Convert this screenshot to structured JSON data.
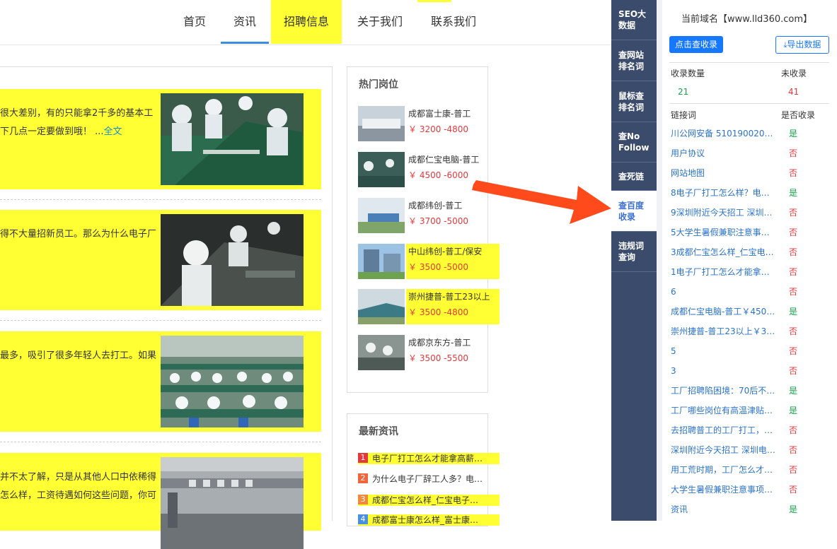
{
  "nav": {
    "items": [
      {
        "label": "首页"
      },
      {
        "label": "资讯"
      },
      {
        "label": "招聘信息"
      },
      {
        "label": "关于我们"
      },
      {
        "label": "联系我们"
      }
    ]
  },
  "articles": [
    {
      "lines": [
        "很大差别，有的只能拿2千多的基本工",
        "下几点一定要做到哦！ ..."
      ],
      "more": "全文"
    },
    {
      "lines": [
        "得不大量招新员工。那么为什么电子厂"
      ],
      "more": ""
    },
    {
      "lines": [
        "最多，吸引了很多年轻人去打工。如果"
      ],
      "more": ""
    },
    {
      "lines": [
        "并不太了解，只是从其他人口中依稀得",
        "怎么样，工资待遇如何这些问题，你可"
      ],
      "more": ""
    }
  ],
  "hot_jobs": {
    "title": "热门岗位",
    "items": [
      {
        "name": "成都富士康-普工",
        "pay": "￥ 3200 -4800"
      },
      {
        "name": "成都仁宝电脑-普工",
        "pay": "￥ 4500 -6000"
      },
      {
        "name": "成都纬创-普工",
        "pay": "￥ 3700 -5000"
      },
      {
        "name": "中山纬创-普工/保安",
        "pay": "￥ 3500 -5000"
      },
      {
        "name": "崇州捷普-普工23以上",
        "pay": "￥ 3500 -4800"
      },
      {
        "name": "成都京东方-普工",
        "pay": "￥ 3500 -5500"
      }
    ]
  },
  "latest_news": {
    "title": "最新资讯",
    "items": [
      {
        "num": "1",
        "text": "电子厂打工怎么才能拿高薪…"
      },
      {
        "num": "2",
        "text": "为什么电子厂辞工人多？电…"
      },
      {
        "num": "3",
        "text": "成都仁宝怎么样_仁宝电子…"
      },
      {
        "num": "4",
        "text": "成都富士康怎么样_富士康…"
      }
    ]
  },
  "seo_sidebar": {
    "tabs": [
      {
        "label": "SEO大数据"
      },
      {
        "label": "查网站排名词"
      },
      {
        "label": "鼠标查排名词"
      },
      {
        "label": "查No Follow"
      },
      {
        "label": "查死链"
      },
      {
        "label": "查百度收录"
      },
      {
        "label": "违规词查询"
      }
    ]
  },
  "seo_panel": {
    "domain_label": "当前域名【www.lld360.com】",
    "check_button": "点击查收录",
    "export_button": "导出数据",
    "indexed_label": "收录数量",
    "not_indexed_label": "未收录",
    "indexed_count": "21",
    "not_indexed_count": "41",
    "col_link": "链接词",
    "col_status": "是否收录",
    "rows": [
      {
        "link": "川公网安备 51019002001…",
        "status": "是"
      },
      {
        "link": "用户协议",
        "status": "否"
      },
      {
        "link": "网站地图",
        "status": "否"
      },
      {
        "link": "8电子厂打工怎么样？电子…",
        "status": "是"
      },
      {
        "link": "9深圳附近今天招工 深圳电…",
        "status": "否"
      },
      {
        "link": "5大学生暑假兼职注意事项…",
        "status": "否"
      },
      {
        "link": "3成都仁宝怎么样_仁宝电…",
        "status": "否"
      },
      {
        "link": "1电子厂打工怎么才能拿高…",
        "status": "否"
      },
      {
        "link": "6",
        "status": "否"
      },
      {
        "link": "成都仁宝电脑-普工￥450…",
        "status": "是"
      },
      {
        "link": "崇州捷普-普工23以上￥3…",
        "status": "否"
      },
      {
        "link": "5",
        "status": "否"
      },
      {
        "link": "3",
        "status": "否"
      },
      {
        "link": "工厂招聘陷困境：70后不…",
        "status": "是"
      },
      {
        "link": "工厂哪些岗位有高温津贴？…",
        "status": "是"
      },
      {
        "link": "去招聘普工的工厂打工，工…",
        "status": "否"
      },
      {
        "link": "深圳附近今天招工 深圳电…",
        "status": "否"
      },
      {
        "link": "用工荒时期，工厂怎么才能…",
        "status": "否"
      },
      {
        "link": "大学生暑假兼职注意事项，…",
        "status": "否"
      },
      {
        "link": "资讯",
        "status": "是"
      }
    ]
  },
  "colors": {
    "highlight": "#ffff33",
    "accent": "#1677ff",
    "sidebar": "#3a4b6b",
    "yes": "#16a34a",
    "no": "#e4393c",
    "arrow": "#ff4a1c"
  }
}
